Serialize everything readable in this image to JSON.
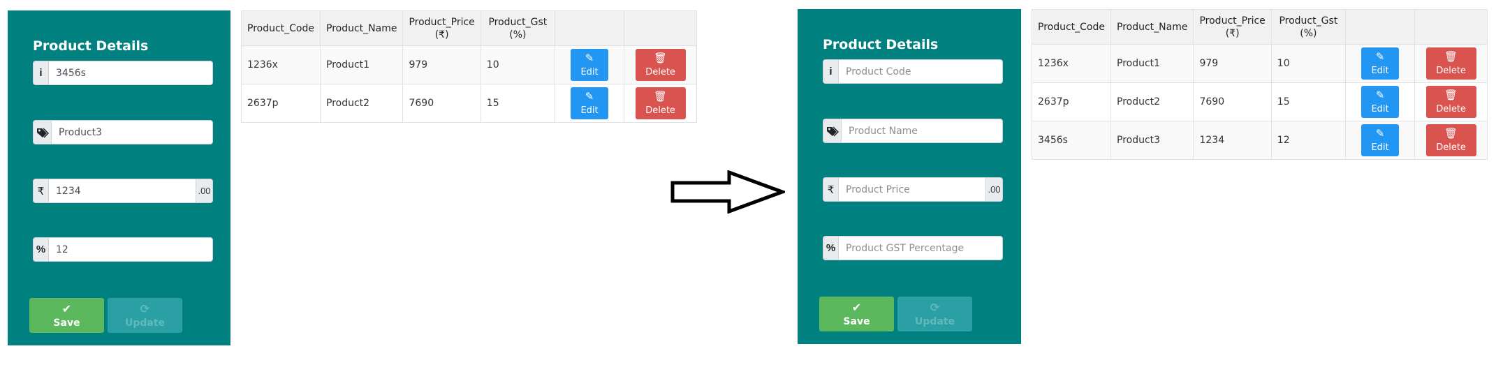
{
  "colors": {
    "panel": "#00807f",
    "save": "#5cb85c",
    "update": "#2aa0a5",
    "edit": "#2196f3",
    "delete": "#d9534f"
  },
  "before": {
    "form": {
      "title": "Product Details",
      "code": {
        "icon": "info-icon",
        "glyph": "i",
        "value": "3456s"
      },
      "name": {
        "icon": "tags-icon",
        "glyph": "🏷",
        "value": "Product3"
      },
      "price": {
        "icon": "rupee-icon",
        "glyph": "₹",
        "value": "1234",
        "suffix": ".00"
      },
      "gst": {
        "icon": "percent-icon",
        "glyph": "%",
        "value": "12"
      },
      "save": {
        "icon": "check-icon",
        "glyph": "✔",
        "label": "Save"
      },
      "update": {
        "icon": "refresh-icon",
        "glyph": "⟳",
        "label": "Update"
      }
    },
    "table": {
      "headers": [
        "Product_Code",
        "Product_Name",
        "Product_Price\n(₹)",
        "Product_Gst\n(%)",
        "",
        ""
      ],
      "rows": [
        {
          "code": "1236x",
          "name": "Product1",
          "price": "979",
          "gst": "10",
          "edit": "Edit",
          "delete": "Delete"
        },
        {
          "code": "2637p",
          "name": "Product2",
          "price": "7690",
          "gst": "15",
          "edit": "Edit",
          "delete": "Delete"
        }
      ]
    }
  },
  "after": {
    "form": {
      "title": "Product Details",
      "code": {
        "icon": "info-icon",
        "glyph": "i",
        "placeholder": "Product Code"
      },
      "name": {
        "icon": "tags-icon",
        "glyph": "🏷",
        "placeholder": "Product Name"
      },
      "price": {
        "icon": "rupee-icon",
        "glyph": "₹",
        "placeholder": "Product Price",
        "suffix": ".00"
      },
      "gst": {
        "icon": "percent-icon",
        "glyph": "%",
        "placeholder": "Product GST Percentage"
      },
      "save": {
        "icon": "check-icon",
        "glyph": "✔",
        "label": "Save"
      },
      "update": {
        "icon": "refresh-icon",
        "glyph": "⟳",
        "label": "Update"
      }
    },
    "table": {
      "headers": [
        "Product_Code",
        "Product_Name",
        "Product_Price\n(₹)",
        "Product_Gst\n(%)",
        "",
        ""
      ],
      "rows": [
        {
          "code": "1236x",
          "name": "Product1",
          "price": "979",
          "gst": "10",
          "edit": "Edit",
          "delete": "Delete"
        },
        {
          "code": "2637p",
          "name": "Product2",
          "price": "7690",
          "gst": "15",
          "edit": "Edit",
          "delete": "Delete"
        },
        {
          "code": "3456s",
          "name": "Product3",
          "price": "1234",
          "gst": "12",
          "edit": "Edit",
          "delete": "Delete"
        }
      ]
    }
  },
  "icons": {
    "edit": "edit-icon",
    "delete": "trash-icon",
    "arrow": "right-arrow-icon"
  },
  "glyphs": {
    "edit": "✎",
    "delete": "🗑"
  }
}
